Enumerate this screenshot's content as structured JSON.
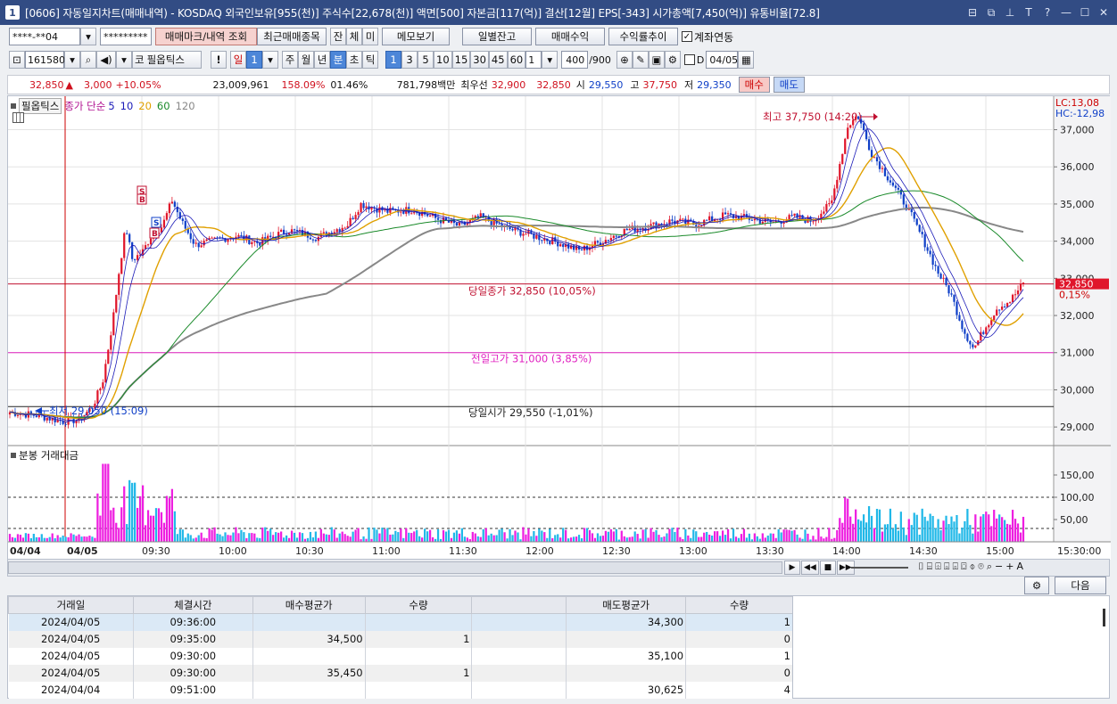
{
  "window": {
    "number": "1",
    "title": "[0606] 자동일지차트(매매내역) - KOSDAQ 외국인보유[955(천)] 주식수[22,678(천)] 액면[500] 자본금[117(억)] 결산[12월] EPS[-343] 시가총액[7,450(억)] 유통비율[72.8]"
  },
  "toolbar1": {
    "account": "****-**04",
    "password": "*********",
    "mark_btn": "매매마크/내역 조회",
    "recent_btn": "최근매매종목",
    "tab_jan": "잔",
    "tab_che": "체",
    "tab_mi": "미",
    "memo_btn": "메모보기",
    "daily_btn": "일별잔고",
    "profit_btn": "매매수익",
    "rate_btn": "수익률추이",
    "link_label": "계좌연동"
  },
  "toolbar2": {
    "code": "161580",
    "prefix": "코",
    "stock_name": "필옵틱스",
    "excl": "!",
    "period_label": "일",
    "period_num": "1",
    "week": "주",
    "month": "월",
    "year": "년",
    "min": "분",
    "sec": "초",
    "tick": "틱",
    "intervals": [
      "1",
      "3",
      "5",
      "10",
      "15",
      "30",
      "45",
      "60"
    ],
    "interval_input": "1",
    "count": "400",
    "count_max": "/900",
    "d_label": "D",
    "date": "04/05"
  },
  "quote": {
    "price": "32,850",
    "change_arrow": "▲",
    "change": "3,000",
    "change_pct": "+10.05%",
    "volume": "23,009,961",
    "vol_ratio": "158.09%",
    "turnover": "01.46%",
    "amount": "781,798백만",
    "best_label": "최우선",
    "ask": "32,900",
    "bid": "32,850",
    "open_label": "시",
    "open": "29,550",
    "high_label": "고",
    "high": "37,750",
    "low_label": "저",
    "low": "29,350",
    "buy_btn": "매수",
    "sell_btn": "매도"
  },
  "chart": {
    "stock_label": "필옵틱스",
    "ma_label": "종가 단순",
    "ma_periods": [
      "5",
      "10",
      "20",
      "60",
      "120"
    ],
    "ma_colors": [
      "#1b1bb8",
      "#1b1bb8",
      "#e0a000",
      "#1a8a2a",
      "#888888"
    ],
    "lc": "LC:13,08",
    "hc": "HC:-12,98",
    "high_ann": "최고 37,750 (14:20)",
    "low_ann": "최저 29,050 (15:09)",
    "close_line": "당일종가 32,850 (10,05%)",
    "prev_high_line": "전일고가 31,000 (3,85%)",
    "open_line": "당일시가 29,550 (-1,01%)",
    "price_tag": "32,850",
    "pct_tag": "0,15%",
    "price_axis": [
      "37,000",
      "36,000",
      "35,000",
      "34,000",
      "33,000",
      "32,000",
      "31,000",
      "30,000",
      "29,000"
    ],
    "volume_label": "분봉 거래대금",
    "vol_axis": [
      "150,00",
      "100,00",
      "50,00"
    ],
    "time_axis": [
      "04/04",
      "04/05",
      "09:30",
      "10:00",
      "10:30",
      "11:00",
      "11:30",
      "12:00",
      "12:30",
      "13:00",
      "13:30",
      "14:00",
      "14:30",
      "15:00",
      "15:30:00"
    ],
    "marks": [
      "S",
      "B",
      "S",
      "B"
    ],
    "up_color": "#e0162b",
    "down_color": "#1040c8"
  },
  "chart_data": {
    "type": "candlestick",
    "y_range": [
      28500,
      37900
    ],
    "high": 37750,
    "low": 29050,
    "open": 29550,
    "close": 32850,
    "prev_high": 31000,
    "x": [
      "04/04",
      "04/05",
      "09:30",
      "10:00",
      "10:30",
      "11:00",
      "11:30",
      "12:00",
      "12:30",
      "13:00",
      "13:30",
      "14:00",
      "14:30",
      "15:00",
      "15:30:00"
    ],
    "vol_range": [
      0,
      200
    ]
  },
  "grid": {
    "next_btn": "다음",
    "columns": [
      "거래일",
      "체결시간",
      "매수평균가",
      "수량",
      "",
      "매도평균가",
      "수량"
    ],
    "rows": [
      [
        "2024/04/05",
        "09:36:00",
        "",
        "",
        "",
        "34,300",
        "1"
      ],
      [
        "2024/04/05",
        "09:35:00",
        "34,500",
        "1",
        "",
        "",
        "0"
      ],
      [
        "2024/04/05",
        "09:30:00",
        "",
        "",
        "",
        "35,100",
        "1"
      ],
      [
        "2024/04/05",
        "09:30:00",
        "35,450",
        "1",
        "",
        "",
        "0"
      ],
      [
        "2024/04/04",
        "09:51:00",
        "",
        "",
        "",
        "30,625",
        "4"
      ]
    ]
  }
}
